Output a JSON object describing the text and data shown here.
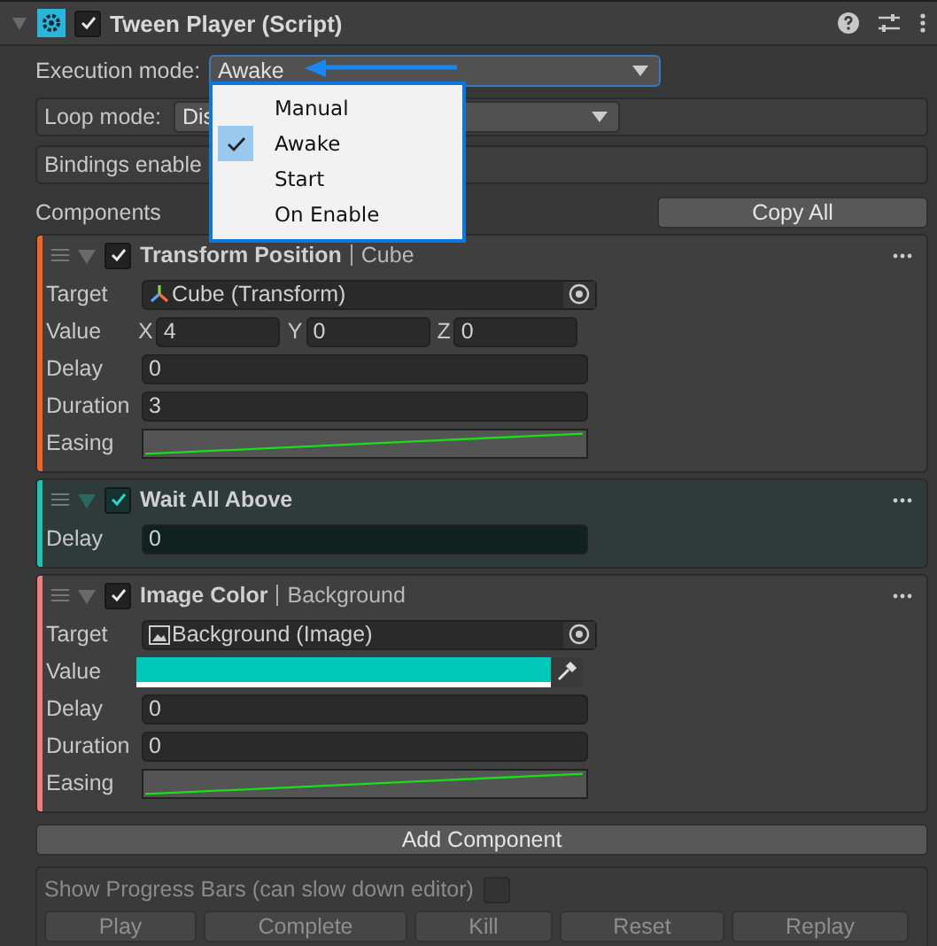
{
  "header": {
    "title": "Tween Player (Script)",
    "enabled": true
  },
  "execution_mode": {
    "label": "Execution mode:",
    "value": "Awake"
  },
  "execution_menu": {
    "options": [
      {
        "label": "Manual",
        "selected": false
      },
      {
        "label": "Awake",
        "selected": true
      },
      {
        "label": "Start",
        "selected": false
      },
      {
        "label": "On Enable",
        "selected": false
      }
    ]
  },
  "loop_mode": {
    "label": "Loop mode:",
    "value": "Dis"
  },
  "bindings": {
    "label": "Bindings enable"
  },
  "components_label": "Components",
  "copy_all": "Copy All",
  "components": [
    {
      "title": "Transform Position",
      "subtitle": "Cube",
      "color": "#f26522",
      "enabled": true,
      "highlighted": false,
      "fields": [
        {
          "kind": "transform",
          "label": "Target",
          "value": "Cube (Transform)"
        },
        {
          "kind": "vector",
          "label": "Value",
          "axes": [
            {
              "axis": "X",
              "value": "4"
            },
            {
              "axis": "Y",
              "value": "0"
            },
            {
              "axis": "Z",
              "value": "0"
            }
          ]
        },
        {
          "kind": "number",
          "label": "Delay",
          "value": "0"
        },
        {
          "kind": "number",
          "label": "Duration",
          "value": "3"
        },
        {
          "kind": "curve",
          "label": "Easing"
        }
      ]
    },
    {
      "title": "Wait All Above",
      "color": "#1fc2b3",
      "enabled": true,
      "highlighted": true,
      "fields": [
        {
          "kind": "number",
          "label": "Delay",
          "value": "0"
        }
      ]
    },
    {
      "title": "Image Color",
      "subtitle": "Background",
      "color": "#f07c7c",
      "enabled": true,
      "highlighted": false,
      "fields": [
        {
          "kind": "image",
          "label": "Target",
          "value": "Background (Image)"
        },
        {
          "kind": "color",
          "label": "Value",
          "color": "#00c8b8"
        },
        {
          "kind": "number",
          "label": "Delay",
          "value": "0"
        },
        {
          "kind": "number",
          "label": "Duration",
          "value": "0"
        },
        {
          "kind": "curve",
          "label": "Easing"
        }
      ]
    }
  ],
  "add_component": "Add Component",
  "progress": {
    "label": "Show Progress Bars (can slow down editor)",
    "checked": false,
    "disabled": true,
    "buttons": [
      "Play",
      "Complete",
      "Kill",
      "Reset",
      "Replay"
    ]
  }
}
